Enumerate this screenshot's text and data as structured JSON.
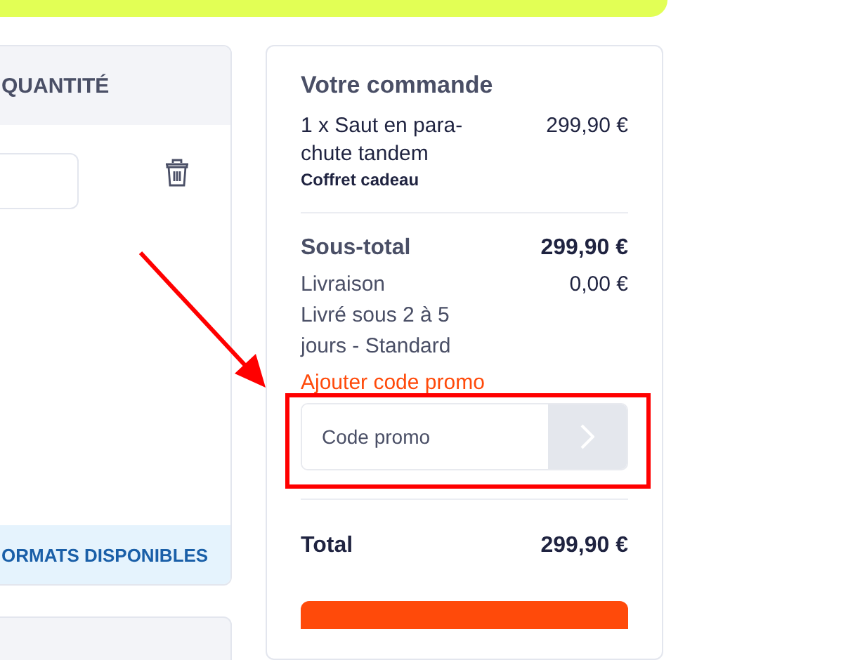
{
  "cart_panel": {
    "header": "QUANTITÉ",
    "formats_link": "ORMATS DISPONIBLES"
  },
  "order_summary": {
    "title": "Votre commande",
    "items": [
      {
        "name": "1 x Saut en para-chute tandem",
        "variant": "Coffret cadeau",
        "price": "299,90 €"
      }
    ],
    "subtotal": {
      "label": "Sous-total",
      "value": "299,90 €"
    },
    "shipping": {
      "label": "Livraison",
      "value": "0,00 €",
      "detail": "Livré sous 2 à 5 jours - Standard"
    },
    "promo": {
      "link": "Ajouter code promo",
      "placeholder": "Code promo"
    },
    "total": {
      "label": "Total",
      "value": "299,90 €"
    }
  }
}
